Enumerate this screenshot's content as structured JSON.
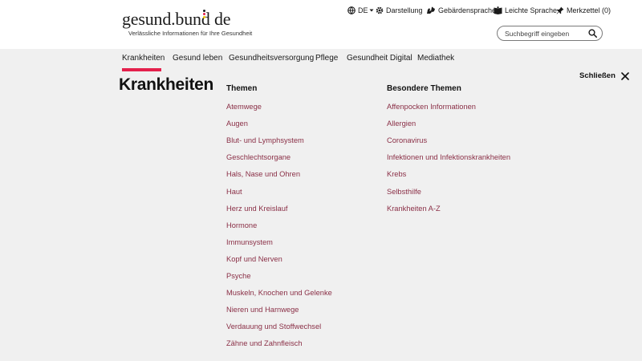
{
  "header": {
    "logo_text": "gesund.bund",
    "logo_tld": "de",
    "tagline": "Verlässliche Informationen für Ihre Gesundheit",
    "logo_colors": [
      "#1e1e1e",
      "#e4204c",
      "#f4c400"
    ]
  },
  "utility": {
    "language": "DE",
    "display": "Darstellung",
    "sign_language": "Gebärdensprache",
    "easy_language": "Leichte Sprache",
    "bookmarks": "Merkzettel (0)"
  },
  "search": {
    "placeholder": "Suchbegriff eingeben"
  },
  "nav": {
    "items": [
      "Krankheiten",
      "Gesund leben",
      "Gesundheitsversorgung",
      "Pflege",
      "Gesundheit Digital",
      "Mediathek"
    ],
    "active": "Krankheiten",
    "accent_color": "#e4204c"
  },
  "menu": {
    "title": "Krankheiten",
    "close_label": "Schließen",
    "themen_title": "Themen",
    "themen": [
      "Atemwege",
      "Augen",
      "Blut- und Lymphsystem",
      "Geschlechtsorgane",
      "Hals, Nase und Ohren",
      "Haut",
      "Herz und Kreislauf",
      "Hormone",
      "Immunsystem",
      "Kopf und Nerven",
      "Psyche",
      "Muskeln, Knochen und Gelenke",
      "Nieren und Harnwege",
      "Verdauung und Stoffwechsel",
      "Zähne und Zahnfleisch"
    ],
    "special_title": "Besondere Themen",
    "special": [
      "Affenpocken Informationen",
      "Allergien",
      "Coronavirus",
      "Infektionen und Infektionskrankheiten",
      "Krebs",
      "Selbsthilfe",
      "Krankheiten A-Z"
    ],
    "link_color": "#8a2f46"
  }
}
